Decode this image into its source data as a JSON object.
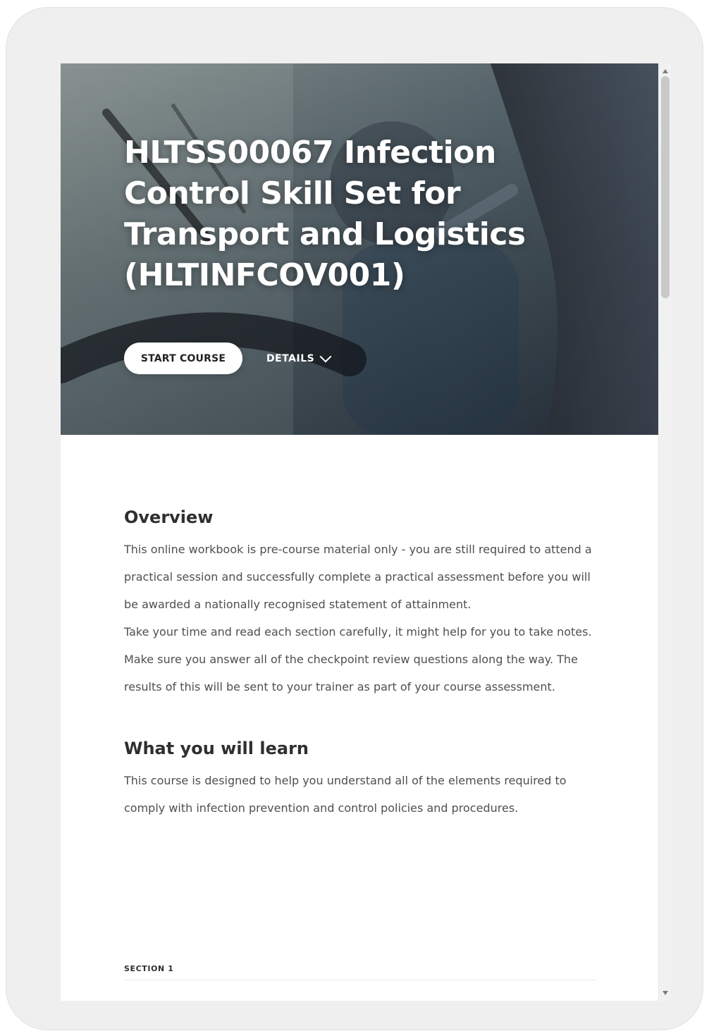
{
  "hero": {
    "title": "HLTSS00067 Infection Control Skill Set for Transport and Logistics (HLTINFCOV001)",
    "start_course_label": "START COURSE",
    "details_label": "DETAILS"
  },
  "overview": {
    "heading": "Overview",
    "paragraphs": [
      "This online workbook is pre-course material only - you are still required to attend a practical session and successfully complete a practical assessment before you will be awarded a nationally recognised statement of attainment.",
      "Take your time and read each section carefully, it might help for you to take notes.",
      "Make sure you answer all of the checkpoint review questions along the way. The results of this will be sent to your trainer as part of your course assessment."
    ]
  },
  "learn": {
    "heading": "What you will learn",
    "paragraph": "This course is designed to help you understand all of the elements required to comply with infection prevention and control policies and procedures."
  },
  "outline": {
    "section_label": "SECTION 1"
  },
  "colors": {
    "frame_bg": "#efefef",
    "content_bg": "#ffffff",
    "text": "#4f4f4f",
    "heading": "#2f2f2f",
    "button_bg": "#ffffff"
  },
  "icons": {
    "details_chevron": "chevron-down-icon"
  }
}
